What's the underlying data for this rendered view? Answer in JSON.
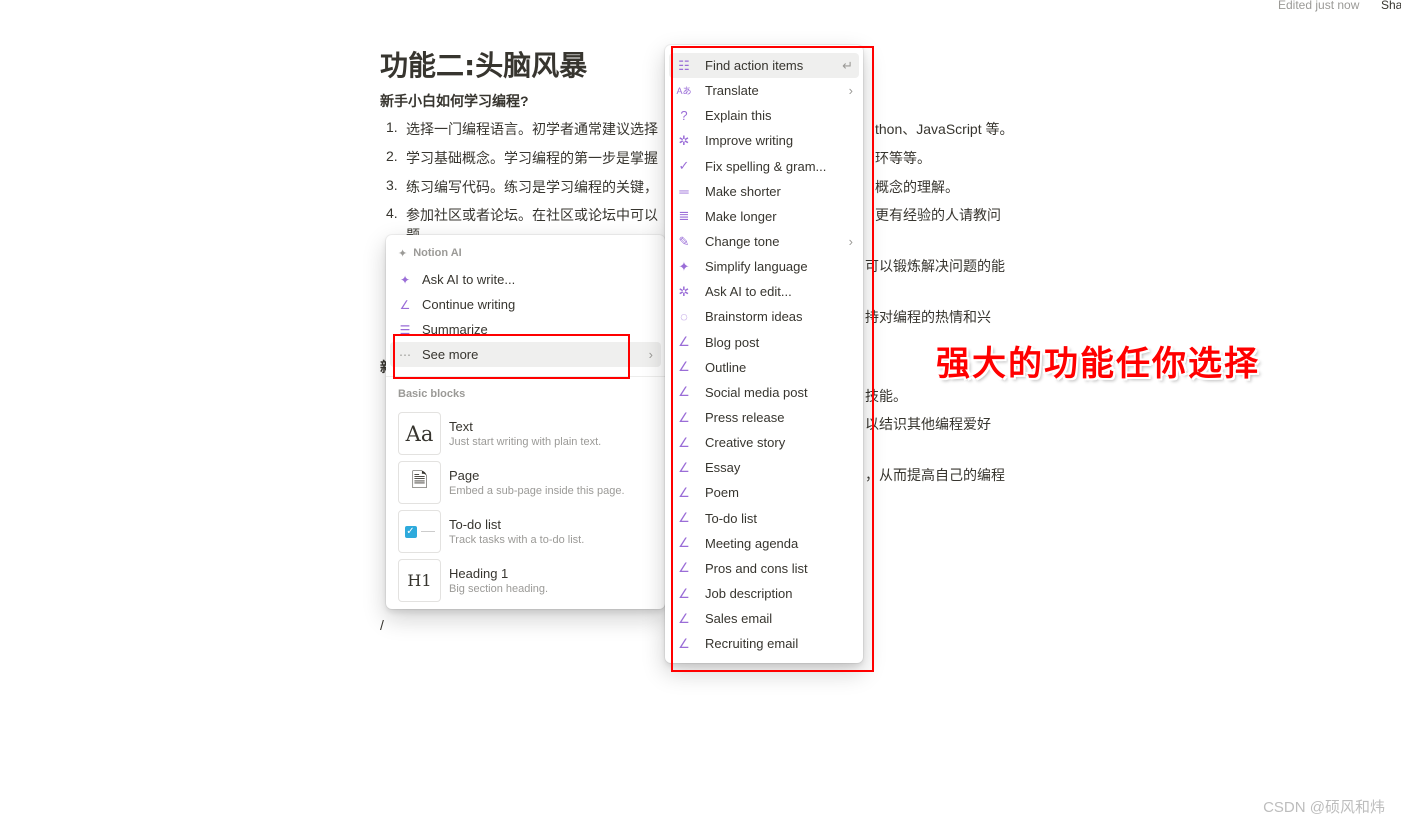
{
  "topbar": {
    "status": "Edited just now",
    "share_label": "Sha"
  },
  "document": {
    "title": "功能二:头脑风暴",
    "question": "新手小白如何学习编程?",
    "list": [
      {
        "num": "1.",
        "left": "选择一门编程语言。初学者通常建议选择",
        "right": "thon、JavaScript 等。"
      },
      {
        "num": "2.",
        "left": "学习基础概念。学习编程的第一步是掌握",
        "right": "环等等。"
      },
      {
        "num": "3.",
        "left": "练习编写代码。练习是学习编程的关键，",
        "right": "概念的理解。"
      },
      {
        "num": "4.",
        "left": "参加社区或者论坛。在社区或论坛中可以",
        "right": "更有经验的人请教问",
        "cont": "题。"
      }
    ],
    "fragments": [
      "可以锻炼解决问题的能",
      "持对编程的热情和兴",
      "技能。",
      "以结识其他编程爱好",
      "，从而提高自己的编程"
    ],
    "left_fragment": "新",
    "slash": "/"
  },
  "slash_menu": {
    "ai_section": "Notion AI",
    "ai_items": [
      {
        "icon": "sparkle-icon",
        "label": "Ask AI to write..."
      },
      {
        "icon": "pen-icon",
        "label": "Continue writing"
      },
      {
        "icon": "summarize-icon",
        "label": "Summarize"
      },
      {
        "icon": "more-icon",
        "label": "See more"
      }
    ],
    "blocks_section": "Basic blocks",
    "blocks": [
      {
        "icon": "Aa",
        "title": "Text",
        "desc": "Just start writing with plain text."
      },
      {
        "icon": "page-icon",
        "title": "Page",
        "desc": "Embed a sub-page inside this page."
      },
      {
        "icon": "checkbox-icon",
        "title": "To-do list",
        "desc": "Track tasks with a to-do list."
      },
      {
        "icon": "H1",
        "title": "Heading 1",
        "desc": "Big section heading."
      }
    ]
  },
  "ai_menu": {
    "accent": "#9a6dd7",
    "items": [
      {
        "icon": "checklist-icon",
        "glyph": "☷",
        "label": "Find action items",
        "trail": "↵"
      },
      {
        "icon": "translate-icon",
        "glyph": "Aあ",
        "label": "Translate",
        "trail": "›"
      },
      {
        "icon": "question-icon",
        "glyph": "?",
        "label": "Explain this"
      },
      {
        "icon": "magic-icon",
        "glyph": "✲",
        "label": "Improve writing"
      },
      {
        "icon": "check-icon",
        "glyph": "✓",
        "label": "Fix spelling & gram..."
      },
      {
        "icon": "short-lines-icon",
        "glyph": "═",
        "label": "Make shorter"
      },
      {
        "icon": "long-lines-icon",
        "glyph": "≣",
        "label": "Make longer"
      },
      {
        "icon": "mic-icon",
        "glyph": "✎",
        "label": "Change tone",
        "trail": "›"
      },
      {
        "icon": "sparkle-icon",
        "glyph": "✦",
        "label": "Simplify language"
      },
      {
        "icon": "magic-icon",
        "glyph": "✲",
        "label": "Ask AI to edit..."
      },
      {
        "icon": "bulb-icon",
        "glyph": "◌",
        "label": "Brainstorm ideas"
      },
      {
        "icon": "pen-icon",
        "glyph": "∠",
        "label": "Blog post"
      },
      {
        "icon": "pen-icon",
        "glyph": "∠",
        "label": "Outline"
      },
      {
        "icon": "pen-icon",
        "glyph": "∠",
        "label": "Social media post"
      },
      {
        "icon": "pen-icon",
        "glyph": "∠",
        "label": "Press release"
      },
      {
        "icon": "pen-icon",
        "glyph": "∠",
        "label": "Creative story"
      },
      {
        "icon": "pen-icon",
        "glyph": "∠",
        "label": "Essay"
      },
      {
        "icon": "pen-icon",
        "glyph": "∠",
        "label": "Poem"
      },
      {
        "icon": "pen-icon",
        "glyph": "∠",
        "label": "To-do list"
      },
      {
        "icon": "pen-icon",
        "glyph": "∠",
        "label": "Meeting agenda"
      },
      {
        "icon": "pen-icon",
        "glyph": "∠",
        "label": "Pros and cons list"
      },
      {
        "icon": "pen-icon",
        "glyph": "∠",
        "label": "Job description"
      },
      {
        "icon": "pen-icon",
        "glyph": "∠",
        "label": "Sales email"
      },
      {
        "icon": "pen-icon",
        "glyph": "∠",
        "label": "Recruiting email"
      }
    ]
  },
  "annotation": "强大的功能任你选择",
  "watermark": "CSDN @硕风和炜"
}
